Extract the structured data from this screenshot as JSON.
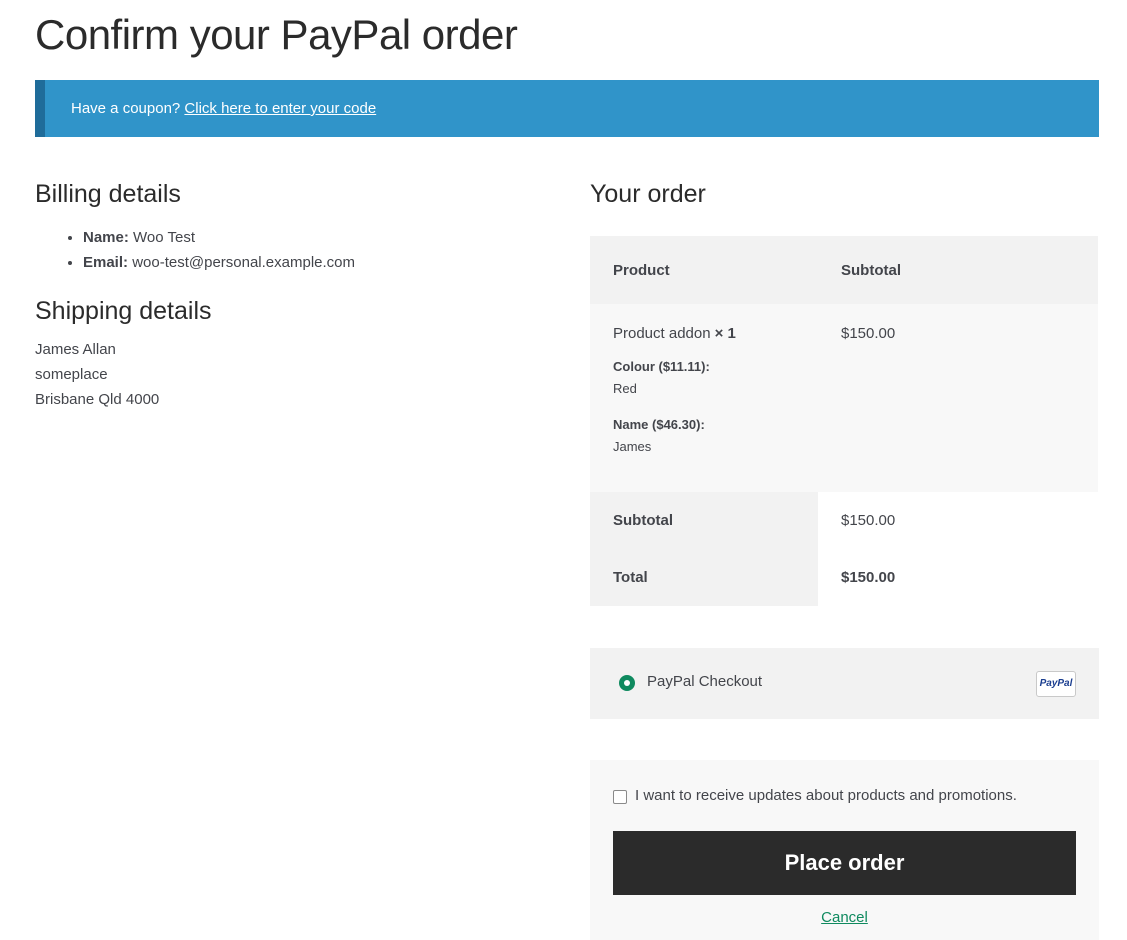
{
  "page": {
    "title": "Confirm your PayPal order"
  },
  "coupon": {
    "text": "Have a coupon?",
    "link": "Click here to enter your code"
  },
  "billing": {
    "heading": "Billing details",
    "name_label": "Name:",
    "name_value": "Woo Test",
    "email_label": "Email:",
    "email_value": "woo-test@personal.example.com"
  },
  "shipping": {
    "heading": "Shipping details",
    "lines": [
      "James Allan",
      "someplace",
      "Brisbane Qld 4000"
    ]
  },
  "order": {
    "heading": "Your order",
    "col_product": "Product",
    "col_subtotal": "Subtotal",
    "item": {
      "name": "Product addon",
      "qty": "× 1",
      "price": "$150.00",
      "meta": [
        {
          "label": "Colour ($11.11):",
          "value": "Red"
        },
        {
          "label": "Name ($46.30):",
          "value": "James"
        }
      ]
    },
    "subtotal_label": "Subtotal",
    "subtotal_value": "$150.00",
    "total_label": "Total",
    "total_value": "$150.00"
  },
  "payment": {
    "method": "PayPal Checkout",
    "logo_text": "PayPal"
  },
  "place": {
    "checkbox_label": "I want to receive updates about products and promotions.",
    "button": "Place order",
    "cancel": "Cancel"
  },
  "colors": {
    "coupon_bg": "#3094c9",
    "accent": "#0f8a5f",
    "button_bg": "#2b2b2b"
  }
}
